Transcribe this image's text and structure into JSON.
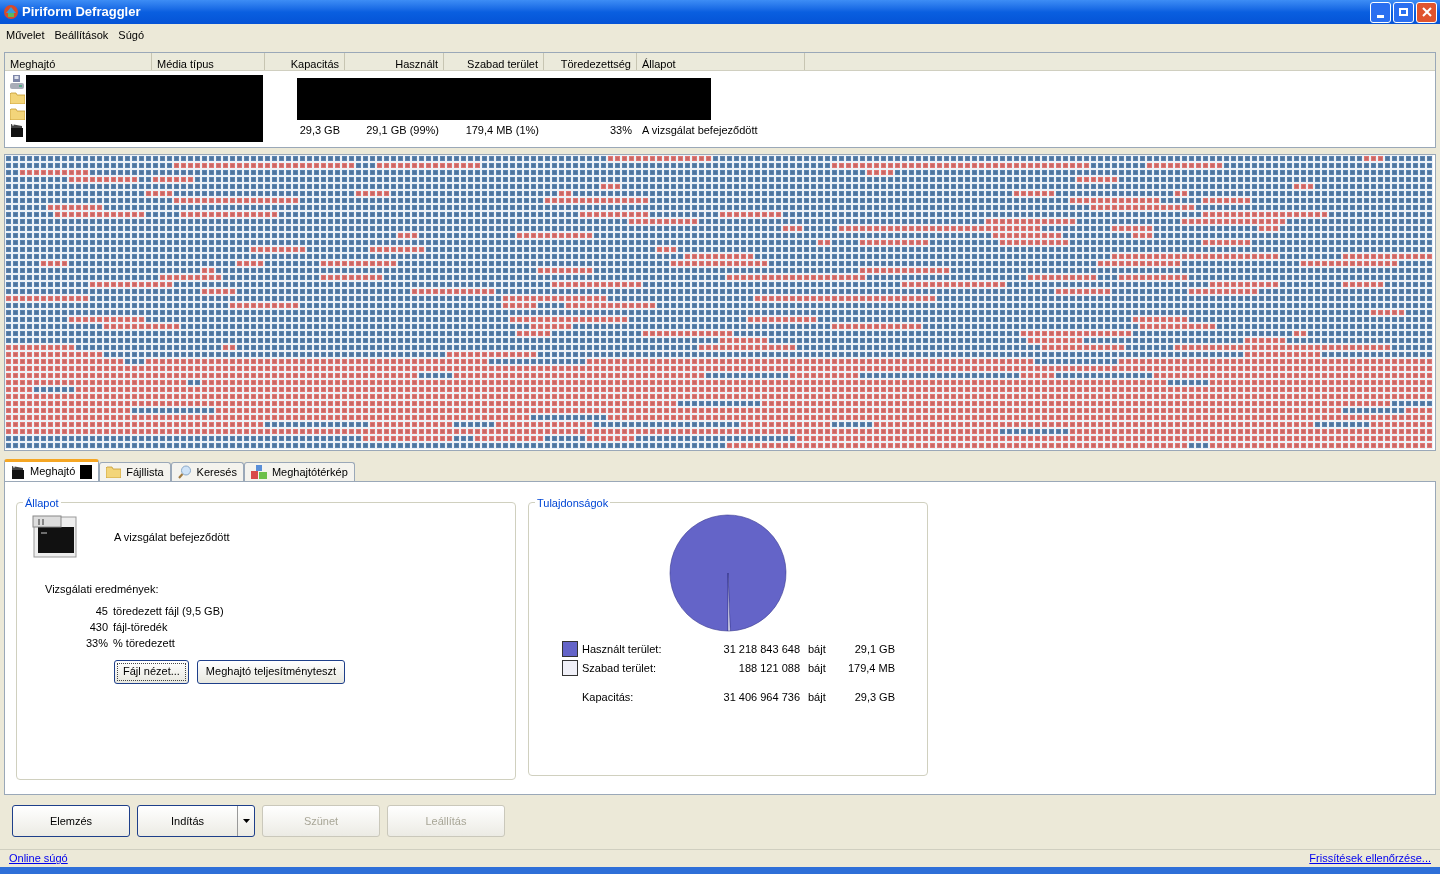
{
  "window": {
    "title": "Piriform Defraggler"
  },
  "menu": [
    "Művelet",
    "Beállítások",
    "Súgó"
  ],
  "drive_list": {
    "columns": [
      "Meghajtó",
      "Média típus",
      "Kapacitás",
      "Használt",
      "Szabad terület",
      "Töredezettség",
      "Állapot"
    ],
    "rows": [
      {
        "kind": "floppy",
        "cells": []
      },
      {
        "kind": "folder",
        "cells": []
      },
      {
        "kind": "folder",
        "cells": []
      },
      {
        "kind": "clapper",
        "cells": [
          "",
          "",
          "29,3 GB",
          "29,1 GB (99%)",
          "179,4 MB (1%)",
          "33%",
          "A vizsgálat befejeződött"
        ]
      }
    ]
  },
  "tabs": [
    {
      "label": "Meghajtó",
      "selected": true
    },
    {
      "label": "Fájllista",
      "selected": false
    },
    {
      "label": "Keresés",
      "selected": false
    },
    {
      "label": "Meghajtótérkép",
      "selected": false
    }
  ],
  "status_group": {
    "title": "Állapot",
    "message": "A vizsgálat befejeződött",
    "results_title": "Vizsgálati eredmények:",
    "results": [
      {
        "count": "45",
        "text": "töredezett fájl (9,5 GB)"
      },
      {
        "count": "430",
        "text": "fájl-töredék"
      },
      {
        "count": "33%",
        "text": "% töredezett"
      }
    ],
    "buttons": [
      {
        "label": "Fájl nézet...",
        "focused": true
      },
      {
        "label": "Meghajtó teljesítményteszt",
        "focused": false
      }
    ]
  },
  "properties": {
    "title": "Tulajdonságok",
    "chart_data": {
      "type": "pie",
      "series": [
        {
          "values": [
            99.4,
            0.6
          ]
        }
      ],
      "colors": [
        "#6464c8",
        "#f0f0f8"
      ]
    },
    "legend": [
      {
        "label": "Használt terület:",
        "bytes": "31 218 843 648",
        "unit": "bájt",
        "size": "29,1 GB",
        "color": "#6464c8"
      },
      {
        "label": "Szabad terület:",
        "bytes": "188 121 088",
        "unit": "bájt",
        "size": "179,4 MB",
        "color": "#f0f0f8"
      }
    ],
    "total": {
      "label": "Kapacitás:",
      "bytes": "31 406 964 736",
      "unit": "bájt",
      "size": "29,3 GB"
    }
  },
  "actions": [
    {
      "label": "Elemzés",
      "disabled": false,
      "dropdown": false
    },
    {
      "label": "Indítás",
      "disabled": false,
      "dropdown": true
    },
    {
      "label": "Szünet",
      "disabled": true,
      "dropdown": false
    },
    {
      "label": "Leállítás",
      "disabled": true,
      "dropdown": false
    }
  ],
  "status_bar": {
    "left_link": "Online súgó",
    "right_link": "Frissítések ellenőrzése..."
  }
}
